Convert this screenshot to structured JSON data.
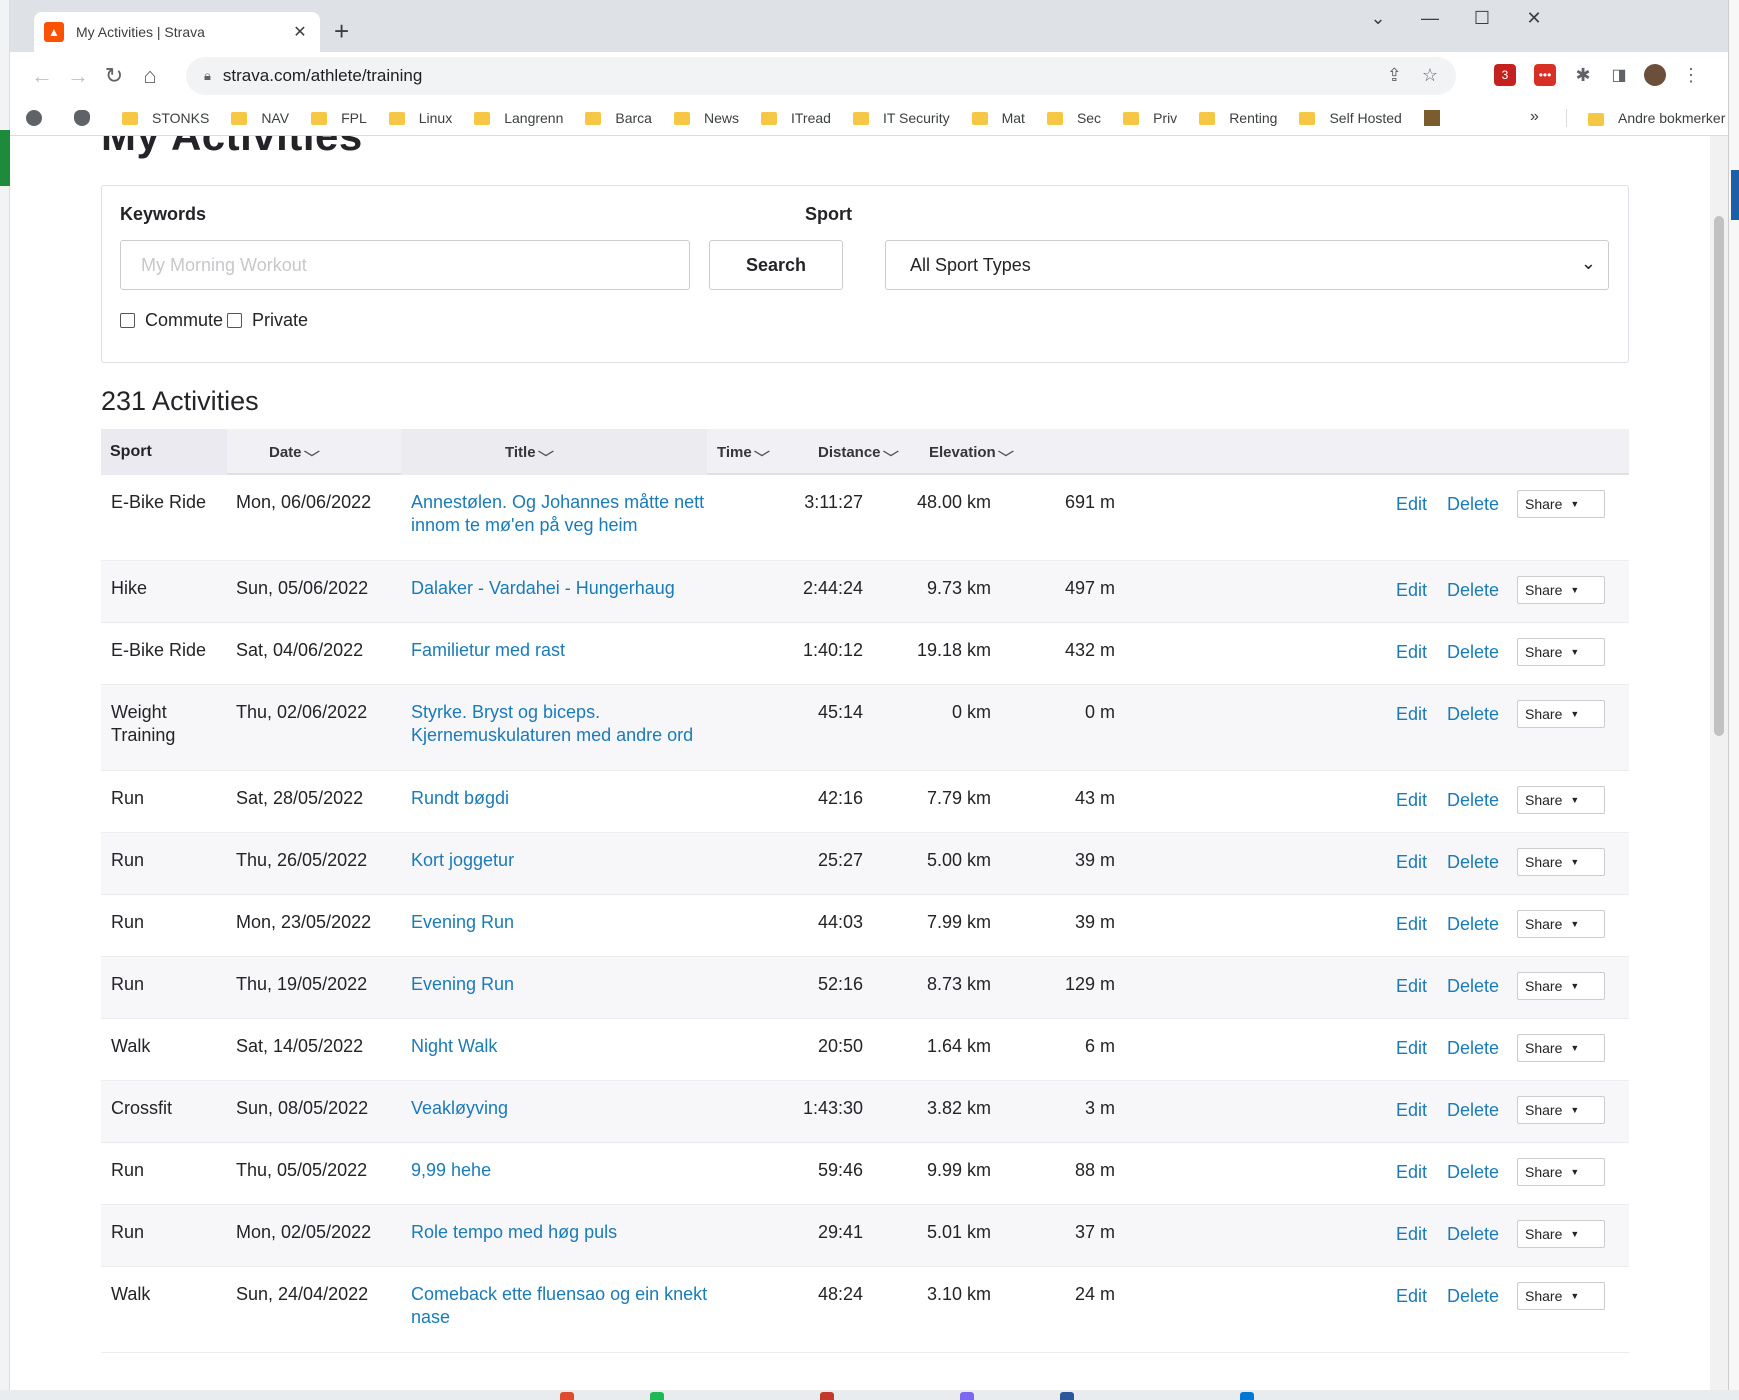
{
  "browser": {
    "tab_title": "My Activities | Strava",
    "tab_favicon_letter": "^",
    "new_tab": "+",
    "url": "strava.com/athlete/training",
    "window_controls": [
      "minimize-icon",
      "maximize-icon",
      "close-icon"
    ],
    "extension_badge": "3",
    "bookmarks": [
      {
        "label": "",
        "icon": "globe-icon"
      },
      {
        "label": "",
        "icon": "apple-icon"
      },
      {
        "label": "STONKS",
        "icon": "folder-icon"
      },
      {
        "label": "NAV",
        "icon": "folder-icon"
      },
      {
        "label": "FPL",
        "icon": "folder-icon"
      },
      {
        "label": "Linux",
        "icon": "folder-icon"
      },
      {
        "label": "Langrenn",
        "icon": "folder-icon"
      },
      {
        "label": "Barca",
        "icon": "folder-icon"
      },
      {
        "label": "News",
        "icon": "folder-icon"
      },
      {
        "label": "ITread",
        "icon": "folder-icon"
      },
      {
        "label": "IT Security",
        "icon": "folder-icon"
      },
      {
        "label": "Mat",
        "icon": "folder-icon"
      },
      {
        "label": "Sec",
        "icon": "folder-icon"
      },
      {
        "label": "Priv",
        "icon": "folder-icon"
      },
      {
        "label": "Renting",
        "icon": "folder-icon"
      },
      {
        "label": "Self Hosted",
        "icon": "folder-icon"
      }
    ],
    "bookmarks_more": "»",
    "other_bookmarks": "Andre bokmerker"
  },
  "page": {
    "title": "My Activities",
    "search": {
      "keywords_label": "Keywords",
      "keywords_placeholder": "My Morning Workout",
      "keywords_value": "",
      "search_button": "Search",
      "sport_label": "Sport",
      "sport_selected": "All Sport Types",
      "commute_label": "Commute",
      "private_label": "Private"
    },
    "activity_count": "231 Activities"
  },
  "table": {
    "headers": {
      "sport": "Sport",
      "date": "Date",
      "title": "Title",
      "time": "Time",
      "distance": "Distance",
      "elevation": "Elevation"
    },
    "action_labels": {
      "edit": "Edit",
      "delete": "Delete",
      "share": "Share"
    },
    "rows": [
      {
        "sport": "E-Bike Ride",
        "date": "Mon, 06/06/2022",
        "title": "Annestølen. Og Johannes måtte nett innom te mø'en på veg heim",
        "time": "3:11:27",
        "distance": "48.00 km",
        "elevation": "691 m"
      },
      {
        "sport": "Hike",
        "date": "Sun, 05/06/2022",
        "title": "Dalaker - Vardahei - Hungerhaug",
        "time": "2:44:24",
        "distance": "9.73 km",
        "elevation": "497 m"
      },
      {
        "sport": "E-Bike Ride",
        "date": "Sat, 04/06/2022",
        "title": "Familietur med rast",
        "time": "1:40:12",
        "distance": "19.18 km",
        "elevation": "432 m"
      },
      {
        "sport": "Weight Training",
        "date": "Thu, 02/06/2022",
        "title": "Styrke. Bryst og biceps. Kjernemuskulaturen med andre ord",
        "time": "45:14",
        "distance": "0 km",
        "elevation": "0 m"
      },
      {
        "sport": "Run",
        "date": "Sat, 28/05/2022",
        "title": "Rundt bøgdi",
        "time": "42:16",
        "distance": "7.79 km",
        "elevation": "43 m"
      },
      {
        "sport": "Run",
        "date": "Thu, 26/05/2022",
        "title": "Kort joggetur",
        "time": "25:27",
        "distance": "5.00 km",
        "elevation": "39 m"
      },
      {
        "sport": "Run",
        "date": "Mon, 23/05/2022",
        "title": "Evening Run",
        "time": "44:03",
        "distance": "7.99 km",
        "elevation": "39 m"
      },
      {
        "sport": "Run",
        "date": "Thu, 19/05/2022",
        "title": "Evening Run",
        "time": "52:16",
        "distance": "8.73 km",
        "elevation": "129 m"
      },
      {
        "sport": "Walk",
        "date": "Sat, 14/05/2022",
        "title": "Night Walk",
        "time": "20:50",
        "distance": "1.64 km",
        "elevation": "6 m"
      },
      {
        "sport": "Crossfit",
        "date": "Sun, 08/05/2022",
        "title": "Veakløyving",
        "time": "1:43:30",
        "distance": "3.82 km",
        "elevation": "3 m"
      },
      {
        "sport": "Run",
        "date": "Thu, 05/05/2022",
        "title": "9,99 hehe",
        "time": "59:46",
        "distance": "9.99 km",
        "elevation": "88 m"
      },
      {
        "sport": "Run",
        "date": "Mon, 02/05/2022",
        "title": "Role tempo med høg puls",
        "time": "29:41",
        "distance": "5.01 km",
        "elevation": "37 m"
      },
      {
        "sport": "Walk",
        "date": "Sun, 24/04/2022",
        "title": "Comeback ette fluensao og ein knekt nase",
        "time": "48:24",
        "distance": "3.10 km",
        "elevation": "24 m"
      }
    ]
  },
  "colors": {
    "strava_orange": "#fc5200",
    "link_blue": "#1a7bb9",
    "header_bg": "#f0f0f5",
    "row_alt_bg": "#f7f7fa",
    "text": "#242428"
  }
}
